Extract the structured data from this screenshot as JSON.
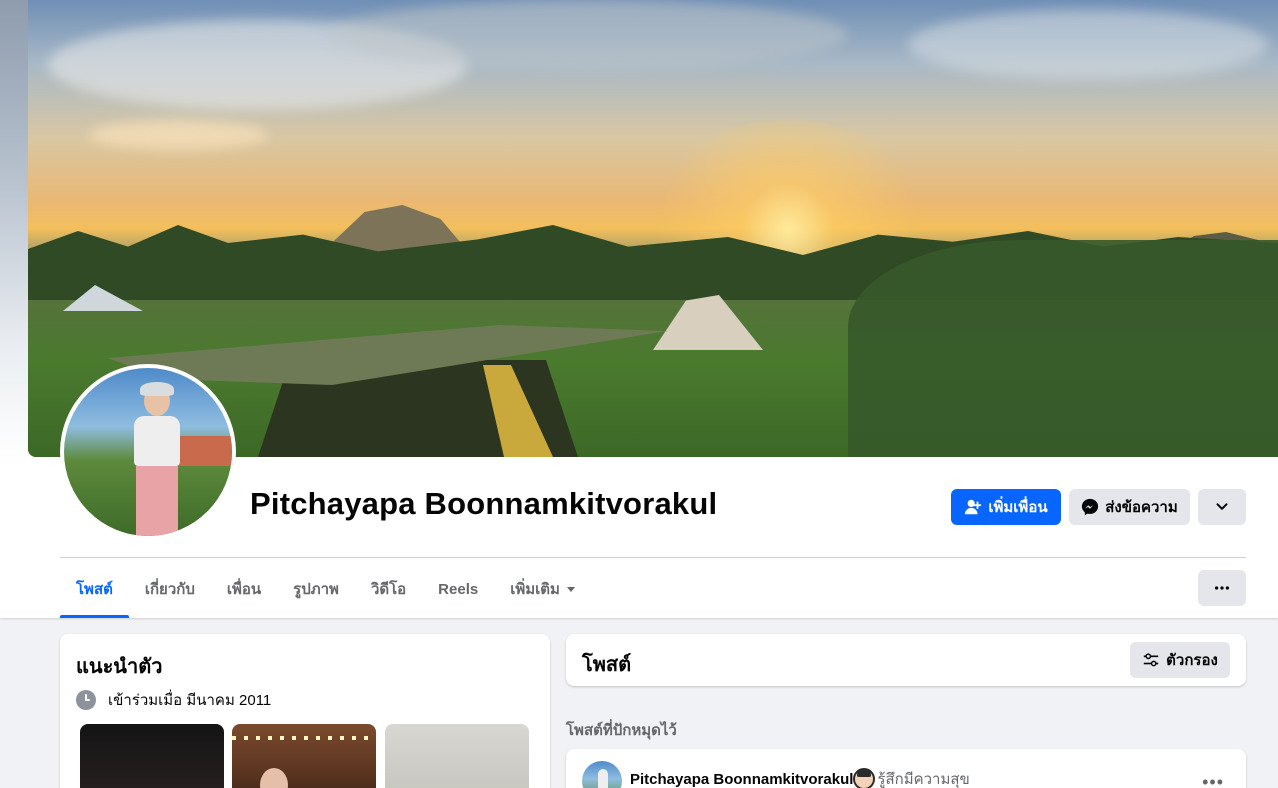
{
  "profile": {
    "name": "Pitchayapa Boonnamkitvorakul"
  },
  "actions": {
    "add_friend_label": "เพิ่มเพื่อน",
    "message_label": "ส่งข้อความ",
    "add_friend_icon": "user-plus-icon",
    "message_icon": "messenger-icon",
    "more_icon": "chevron-down-icon"
  },
  "tabs": [
    {
      "label": "โพสต์",
      "active": true
    },
    {
      "label": "เกี่ยวกับ"
    },
    {
      "label": "เพื่อน"
    },
    {
      "label": "รูปภาพ"
    },
    {
      "label": "วิดีโอ"
    },
    {
      "label": "Reels"
    },
    {
      "label": "เพิ่มเติม"
    }
  ],
  "tabs_more_icon": "ellipsis-icon",
  "intro": {
    "title": "แนะนำตัว",
    "joined": "เข้าร่วมเมื่อ มีนาคม 2011",
    "icon": "clock-icon"
  },
  "posts": {
    "title": "โพสต์",
    "filter_label": "ตัวกรอง",
    "filter_icon": "sliders-icon",
    "pinned_label": "โพสต์ที่ปักหมุดไว้",
    "pinned_post": {
      "author": "Pitchayapa Boonnamkitvorakul",
      "feeling": "รู้สึกมีความสุข",
      "menu": "•••"
    }
  },
  "colors": {
    "primary": "#0866ff",
    "secondary_button": "#e4e6eb",
    "background": "#f0f2f5",
    "muted_text": "#65676b"
  }
}
